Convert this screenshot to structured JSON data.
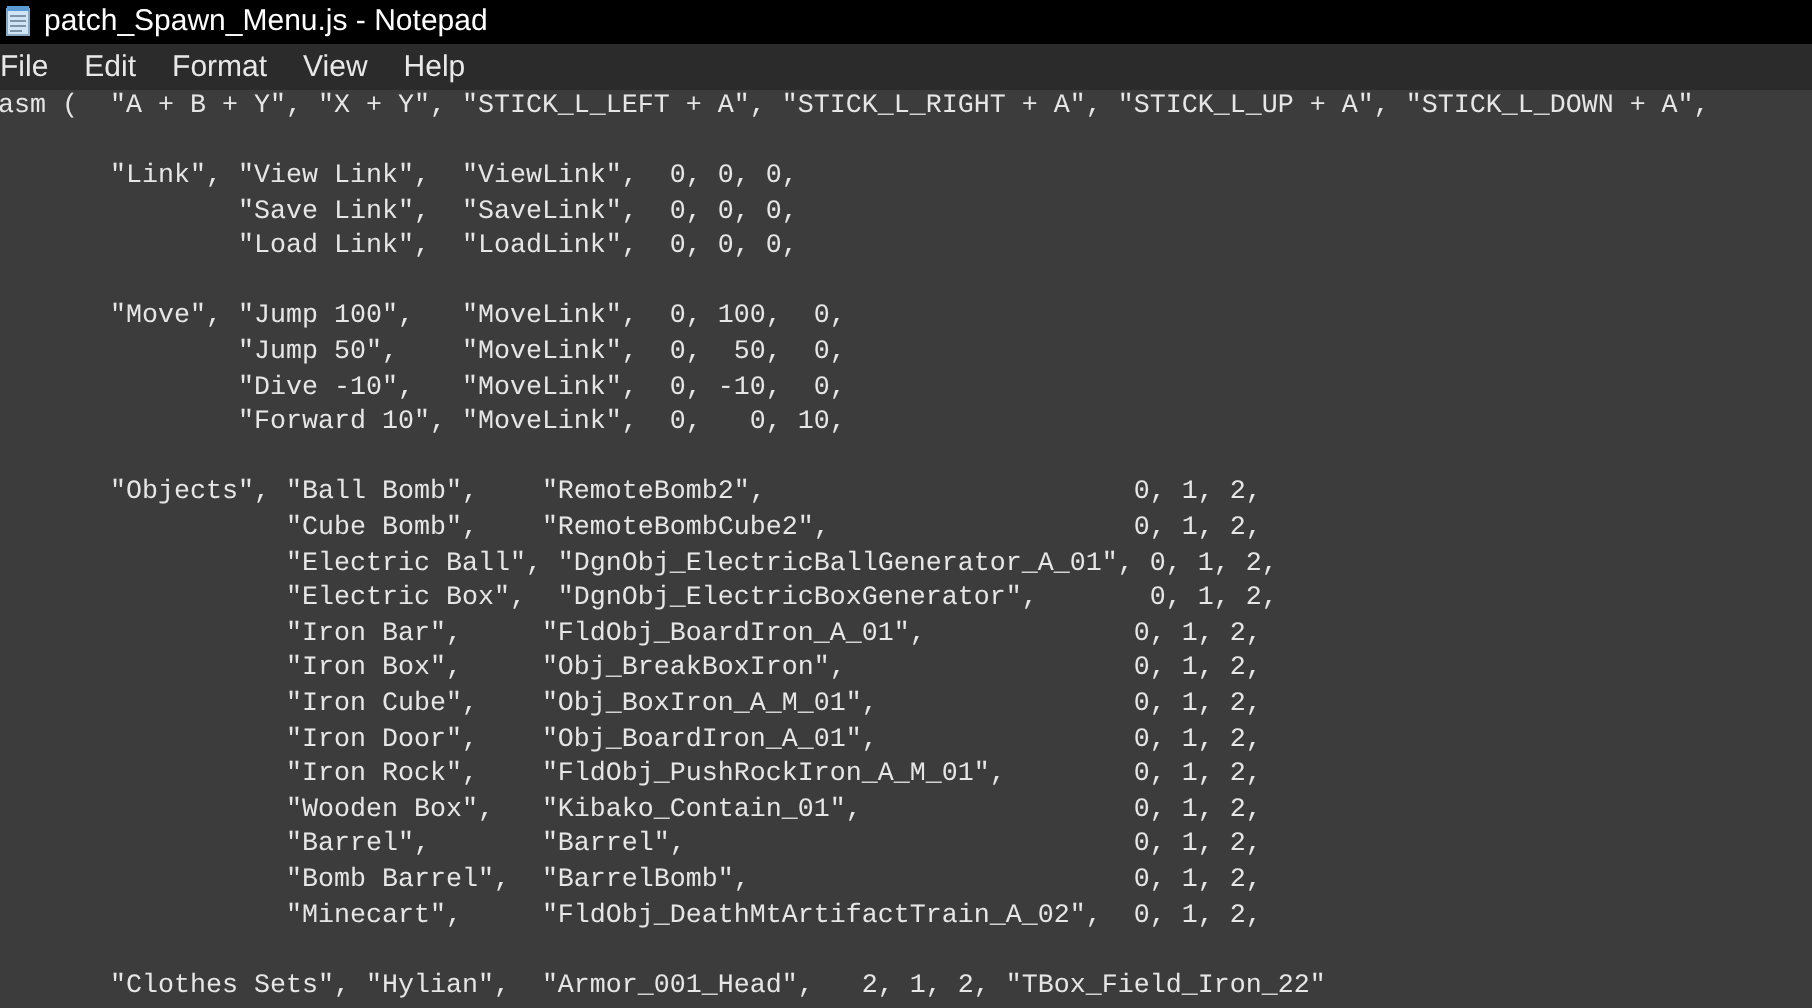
{
  "window": {
    "title": "patch_Spawn_Menu.js - Notepad"
  },
  "menu": [
    {
      "label": "File"
    },
    {
      "label": "Edit"
    },
    {
      "label": "Format"
    },
    {
      "label": "View"
    },
    {
      "label": "Help"
    }
  ],
  "editor": {
    "lines": [
      {
        "kind": "code",
        "text": "asm (  \"A + B + Y\", \"X + Y\", \"STICK_L_LEFT + A\", \"STICK_L_RIGHT + A\", \"STICK_L_UP + A\", \"STICK_L_DOWN + A\","
      },
      {
        "kind": "blank"
      },
      {
        "kind": "code",
        "text": "       \"Link\", \"View Link\",  \"ViewLink\",  0, 0, 0,"
      },
      {
        "kind": "code",
        "text": "               \"Save Link\",  \"SaveLink\",  0, 0, 0,"
      },
      {
        "kind": "code",
        "text": "               \"Load Link\",  \"LoadLink\",  0, 0, 0,"
      },
      {
        "kind": "blank"
      },
      {
        "kind": "code",
        "text": "       \"Move\", \"Jump 100\",   \"MoveLink\",  0, 100,  0,"
      },
      {
        "kind": "code",
        "text": "               \"Jump 50\",    \"MoveLink\",  0,  50,  0,"
      },
      {
        "kind": "code",
        "text": "               \"Dive -10\",   \"MoveLink\",  0, -10,  0,"
      },
      {
        "kind": "code",
        "text": "               \"Forward 10\", \"MoveLink\",  0,   0, 10,"
      },
      {
        "kind": "blank"
      },
      {
        "kind": "code",
        "text": "       \"Objects\", \"Ball Bomb\",    \"RemoteBomb2\",                       0, 1, 2,"
      },
      {
        "kind": "code",
        "text": "                  \"Cube Bomb\",    \"RemoteBombCube2\",                   0, 1, 2,"
      },
      {
        "kind": "code",
        "text": "                  \"Electric Ball\", \"DgnObj_ElectricBallGenerator_A_01\", 0, 1, 2,"
      },
      {
        "kind": "code",
        "text": "                  \"Electric Box\",  \"DgnObj_ElectricBoxGenerator\",       0, 1, 2,"
      },
      {
        "kind": "code",
        "text": "                  \"Iron Bar\",     \"FldObj_BoardIron_A_01\",             0, 1, 2,"
      },
      {
        "kind": "code",
        "text": "                  \"Iron Box\",     \"Obj_BreakBoxIron\",                  0, 1, 2,"
      },
      {
        "kind": "code",
        "text": "                  \"Iron Cube\",    \"Obj_BoxIron_A_M_01\",                0, 1, 2,"
      },
      {
        "kind": "code",
        "text": "                  \"Iron Door\",    \"Obj_BoardIron_A_01\",                0, 1, 2,"
      },
      {
        "kind": "code",
        "text": "                  \"Iron Rock\",    \"FldObj_PushRockIron_A_M_01\",        0, 1, 2,"
      },
      {
        "kind": "code",
        "text": "                  \"Wooden Box\",   \"Kibako_Contain_01\",                 0, 1, 2,"
      },
      {
        "kind": "code",
        "text": "                  \"Barrel\",       \"Barrel\",                            0, 1, 2,"
      },
      {
        "kind": "code",
        "text": "                  \"Bomb Barrel\",  \"BarrelBomb\",                        0, 1, 2,"
      },
      {
        "kind": "code",
        "text": "                  \"Minecart\",     \"FldObj_DeathMtArtifactTrain_A_02\",  0, 1, 2,"
      },
      {
        "kind": "blank"
      },
      {
        "kind": "code",
        "text": "       \"Clothes Sets\", \"Hylian\",  \"Armor_001_Head\",   2, 1, 2, \"TBox_Field_Iron_22\""
      }
    ]
  }
}
